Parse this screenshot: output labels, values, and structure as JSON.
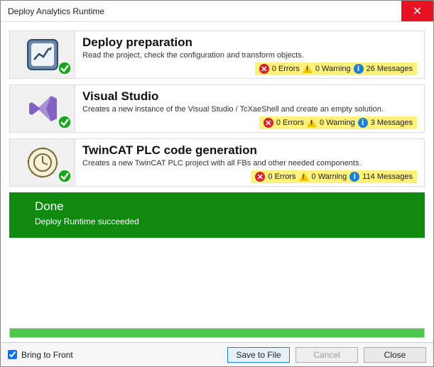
{
  "window": {
    "title": "Deploy Analytics Runtime",
    "close_glyph": "✕"
  },
  "steps": [
    {
      "title": "Deploy preparation",
      "desc": "Read the project, check the configuration and transform objects.",
      "errors": "0 Errors",
      "warnings": "0 Warning",
      "messages": "26 Messages"
    },
    {
      "title": "Visual Studio",
      "desc": "Creates a new instance of the Visual Studio / TcXaeShell and create an empty solution.",
      "errors": "0 Errors",
      "warnings": "0 Warning",
      "messages": "3 Messages"
    },
    {
      "title": "TwinCAT PLC code generation",
      "desc": "Creates a new TwinCAT PLC project with all FBs and other needed components.",
      "errors": "0 Errors",
      "warnings": "0 Warning",
      "messages": "114 Messages"
    }
  ],
  "done": {
    "title": "Done",
    "sub": "Deploy Runtime succeeded"
  },
  "footer": {
    "bring_to_front": "Bring to Front",
    "save": "Save to File",
    "cancel": "Cancel",
    "close": "Close"
  }
}
